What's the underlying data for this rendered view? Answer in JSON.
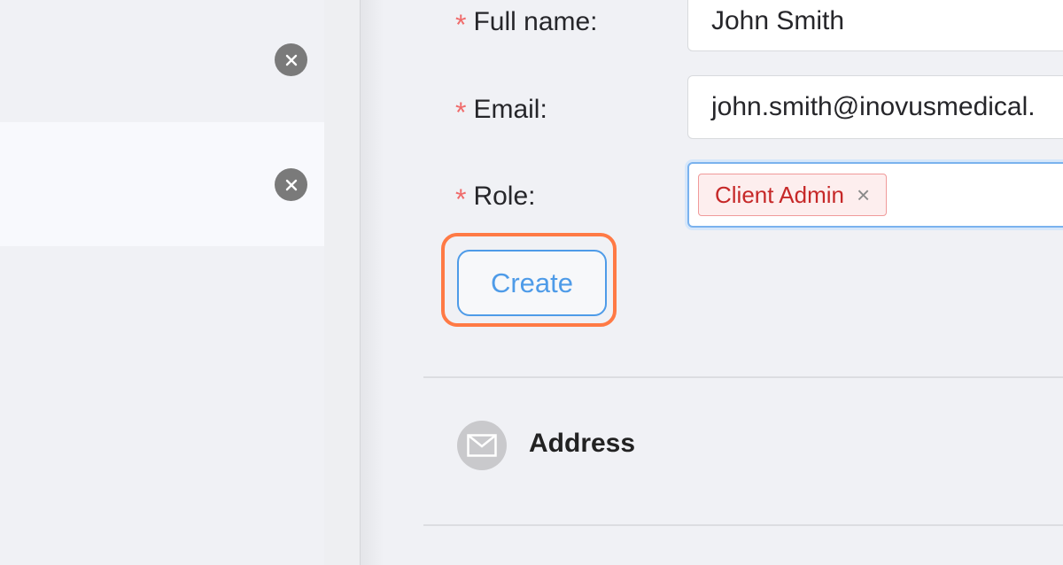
{
  "left_panel": {
    "clear_icons": [
      "close-icon",
      "close-icon"
    ]
  },
  "form": {
    "full_name": {
      "label": "Full name:",
      "value": "John Smith",
      "required_mark": "*"
    },
    "email": {
      "label": "Email:",
      "value": "john.smith@inovusmedical.",
      "required_mark": "*"
    },
    "role": {
      "label": "Role:",
      "required_mark": "*",
      "selected_tags": [
        {
          "text": "Client Admin",
          "remove_symbol": "×"
        }
      ]
    },
    "create_button": "Create"
  },
  "address_section": {
    "title": "Address",
    "icon": "envelope-icon"
  },
  "colors": {
    "required": "#f06b6b",
    "accent": "#4e9be8",
    "tag_text": "#c62828",
    "highlight": "#ff7a45"
  }
}
